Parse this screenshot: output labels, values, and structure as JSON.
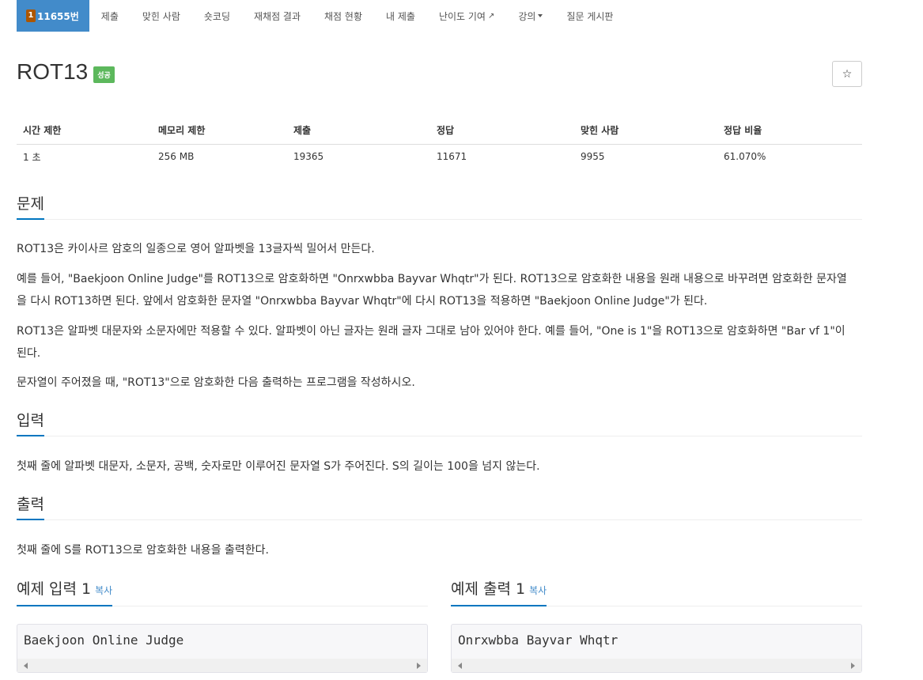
{
  "nav": {
    "problem_medal": "1",
    "problem_tab": "11655번",
    "items": [
      "제출",
      "맞힌 사람",
      "숏코딩",
      "재채점 결과",
      "채점 현황",
      "내 제출",
      "난이도 기여",
      "강의",
      "질문 게시판"
    ],
    "icons": {
      "external": "external-link-icon",
      "dropdown": "caret-down-icon",
      "medal": "tier-medal-icon"
    }
  },
  "title": {
    "text": "ROT13",
    "badge": "성공",
    "badge_color": "#5cb85c",
    "star": "☆"
  },
  "info": {
    "headers": [
      "시간 제한",
      "메모리 제한",
      "제출",
      "정답",
      "맞힌 사람",
      "정답 비율"
    ],
    "values": [
      "1 초",
      "256 MB",
      "19365",
      "11671",
      "9955",
      "61.070%"
    ]
  },
  "sections": {
    "problem_heading": "문제",
    "problem_paras": [
      "ROT13은 카이사르 암호의 일종으로 영어 알파벳을 13글자씩 밀어서 만든다.",
      "예를 들어, \"Baekjoon Online Judge\"를 ROT13으로 암호화하면 \"Onrxwbba Bayvar Whqtr\"가 된다. ROT13으로 암호화한 내용을 원래 내용으로 바꾸려면 암호화한 문자열을 다시 ROT13하면 된다. 앞에서 암호화한 문자열 \"Onrxwbba Bayvar Whqtr\"에 다시 ROT13을 적용하면 \"Baekjoon Online Judge\"가 된다.",
      "ROT13은 알파벳 대문자와 소문자에만 적용할 수 있다. 알파벳이 아닌 글자는 원래 글자 그대로 남아 있어야 한다. 예를 들어, \"One is 1\"을 ROT13으로 암호화하면 \"Bar vf 1\"이 된다.",
      "문자열이 주어졌을 때, \"ROT13\"으로 암호화한 다음 출력하는 프로그램을 작성하시오."
    ],
    "input_heading": "입력",
    "input_text": "첫째 줄에 알파벳 대문자, 소문자, 공백, 숫자로만 이루어진 문자열 S가 주어진다. S의 길이는 100을 넘지 않는다.",
    "output_heading": "출력",
    "output_text": "첫째 줄에 S를 ROT13으로 암호화한 내용을 출력한다."
  },
  "samples": {
    "input_heading": "예제 입력 1",
    "output_heading": "예제 출력 1",
    "copy_label": "복사",
    "input_value": "Baekjoon Online Judge",
    "output_value": "Onrxwbba Bayvar Whqtr"
  },
  "colors": {
    "nav_active": "#428bca",
    "section_underline": "#0076c0",
    "link": "#428bca"
  }
}
